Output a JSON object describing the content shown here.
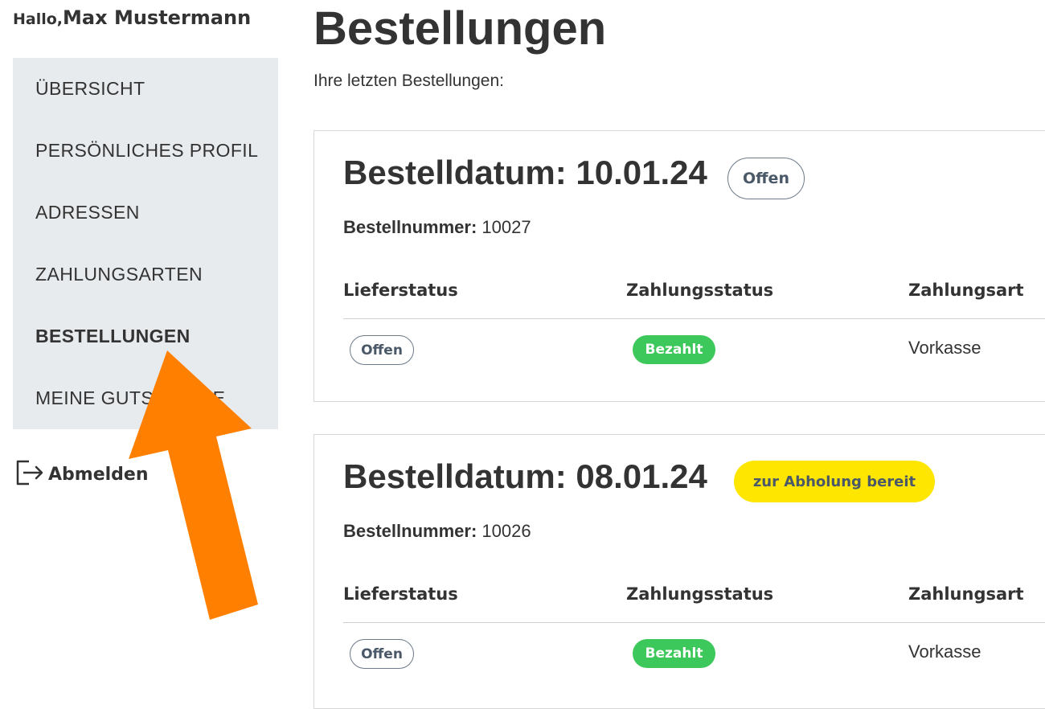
{
  "greeting": {
    "hello": "Hallo,",
    "name": "Max Mustermann"
  },
  "sidebar": {
    "items": [
      {
        "label": "ÜBERSICHT",
        "active": false
      },
      {
        "label": "PERSÖNLICHES PROFIL",
        "active": false
      },
      {
        "label": "ADRESSEN",
        "active": false
      },
      {
        "label": "ZAHLUNGSARTEN",
        "active": false
      },
      {
        "label": "BESTELLUNGEN",
        "active": true
      },
      {
        "label": "MEINE GUTSCHEINE",
        "active": false
      }
    ],
    "logout_label": "Abmelden"
  },
  "main": {
    "title": "Bestellungen",
    "subtitle": "Ihre letzten Bestellungen:"
  },
  "orders": [
    {
      "date_label": "Bestelldatum: 10.01.24",
      "status_badge": "Offen",
      "number_key": "Bestellnummer:",
      "number_value": "10027",
      "headers": [
        "Lieferstatus",
        "Zahlungsstatus",
        "Zahlungsart"
      ],
      "delivery_status": "Offen",
      "payment_status": "Bezahlt",
      "payment_method": "Vorkasse"
    },
    {
      "date_label": "Bestelldatum: 08.01.24",
      "status_badge": "zur Abholung bereit",
      "number_key": "Bestellnummer:",
      "number_value": "10026",
      "headers": [
        "Lieferstatus",
        "Zahlungsstatus",
        "Zahlungsart"
      ],
      "delivery_status": "Offen",
      "payment_status": "Bezahlt",
      "payment_method": "Vorkasse"
    }
  ],
  "colors": {
    "sidebar_bg": "#e8ebee",
    "badge_yellow": "#ffe600",
    "badge_green": "#3cc85a",
    "badge_outline": "#6c7a89",
    "arrow": "#ff8000"
  },
  "icons": {
    "logout": "logout-icon",
    "pointer": "arrow-pointer"
  }
}
